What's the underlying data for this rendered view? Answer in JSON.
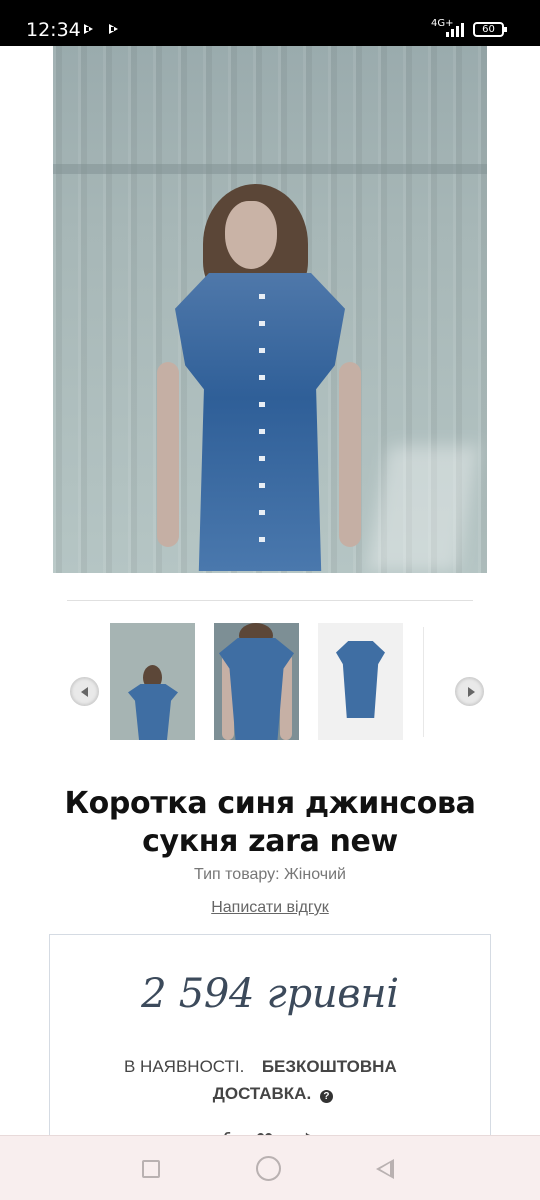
{
  "status_bar": {
    "time": "12:34",
    "network": "4G+",
    "battery": "60",
    "icons": [
      "play-icon",
      "play-icon",
      "signal-icon",
      "battery-icon"
    ]
  },
  "product": {
    "title": "Коротка синя джинсова сукня zara new",
    "type_label": "Тип товару:",
    "type_value": "Жіночий",
    "review_label": "Написати відгук",
    "price": "2 594 гривні",
    "availability": "В НАЯВНОСТІ.",
    "delivery_line1": "БЕЗКОШТОВНА",
    "delivery_line2": "ДОСТАВКА.",
    "help_icon": "?"
  },
  "gallery": {
    "prev_icon": "chevron-left-icon",
    "next_icon": "chevron-right-icon",
    "thumbnails": [
      "model-front-wide",
      "model-front-close",
      "dress-flatlay"
    ]
  },
  "social": {
    "icons": [
      "facebook-icon",
      "twitter-icon",
      "pinterest-icon"
    ],
    "visible_text": "f ♥ ♪"
  },
  "system_navigation": {
    "recent_icon": "square-icon",
    "home_icon": "circle-icon",
    "back_icon": "triangle-back-icon"
  },
  "colors": {
    "title": "#111111",
    "price": "#3c4a5b",
    "muted": "#777777",
    "border": "#d5dbe3",
    "nav_bar": "#f8eeee"
  }
}
